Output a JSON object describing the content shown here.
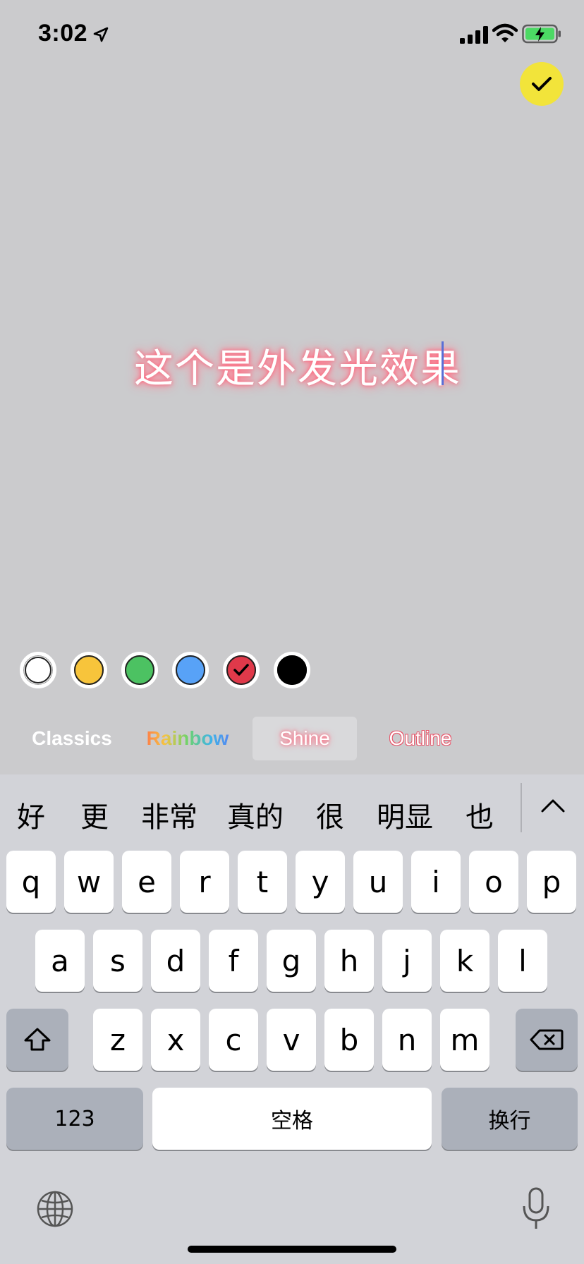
{
  "status_bar": {
    "time": "3:02"
  },
  "editor": {
    "text": "这个是外发光效果"
  },
  "color_swatches": [
    {
      "name": "white",
      "color": "#ffffff",
      "selected": false
    },
    {
      "name": "yellow",
      "color": "#f7c43b",
      "selected": false
    },
    {
      "name": "green",
      "color": "#4cc262",
      "selected": false
    },
    {
      "name": "blue",
      "color": "#58a2f7",
      "selected": false
    },
    {
      "name": "red",
      "color": "#e0394a",
      "selected": true
    },
    {
      "name": "black",
      "color": "#000000",
      "selected": false
    }
  ],
  "style_tabs": {
    "classics": "Classics",
    "rainbow": "Rainbow",
    "shine": "Shine",
    "outline": "Outline",
    "selected": "Shine"
  },
  "keyboard": {
    "suggestions": [
      "好",
      "更",
      "非常",
      "真的",
      "很",
      "明显",
      "也"
    ],
    "row1": [
      "q",
      "w",
      "e",
      "r",
      "t",
      "y",
      "u",
      "i",
      "o",
      "p"
    ],
    "row2": [
      "a",
      "s",
      "d",
      "f",
      "g",
      "h",
      "j",
      "k",
      "l"
    ],
    "row3": [
      "z",
      "x",
      "c",
      "v",
      "b",
      "n",
      "m"
    ],
    "numbers_label": "123",
    "space_label": "空格",
    "return_label": "换行"
  },
  "colors": {
    "accent_done": "#f2e43a",
    "glow": "#ff7b8f",
    "caret": "#5a6fd6"
  }
}
